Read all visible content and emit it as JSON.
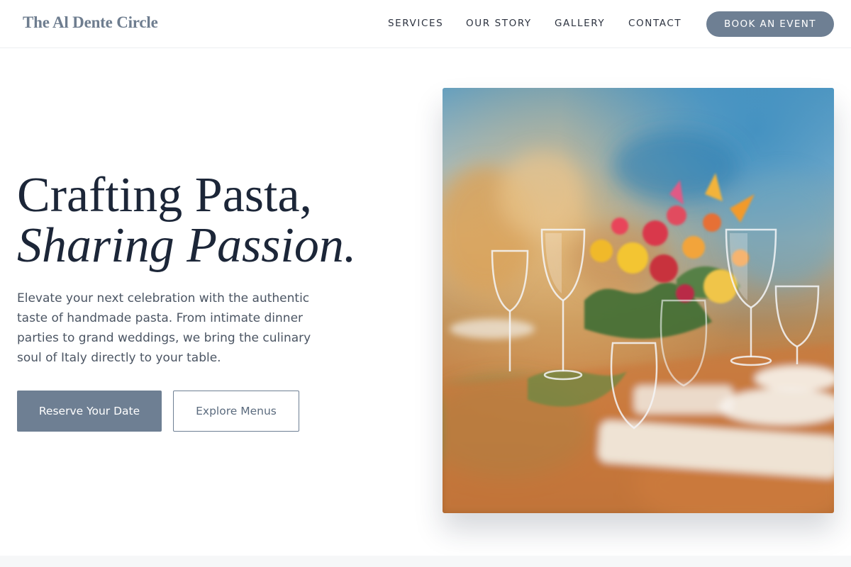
{
  "header": {
    "brand": "The Al Dente Circle",
    "nav": [
      {
        "label": "SERVICES"
      },
      {
        "label": "OUR STORY"
      },
      {
        "label": "GALLERY"
      },
      {
        "label": "CONTACT"
      }
    ],
    "cta_label": "BOOK AN EVENT"
  },
  "hero": {
    "title_line1": "Crafting Pasta,",
    "title_line2": "Sharing Passion.",
    "description": "Elevate your next celebration with the authentic taste of handmade pasta. From intimate dinner parties to grand weddings, we bring the culinary soul of Italy directly to your table.",
    "primary_button": "Reserve Your Date",
    "secondary_button": "Explore Menus",
    "image_alt": "Elegant banquet table with wine glasses and a colorful floral centerpiece"
  },
  "colors": {
    "accent": "#6e7f93",
    "heading": "#1c2638",
    "body_text": "#4b5563"
  }
}
